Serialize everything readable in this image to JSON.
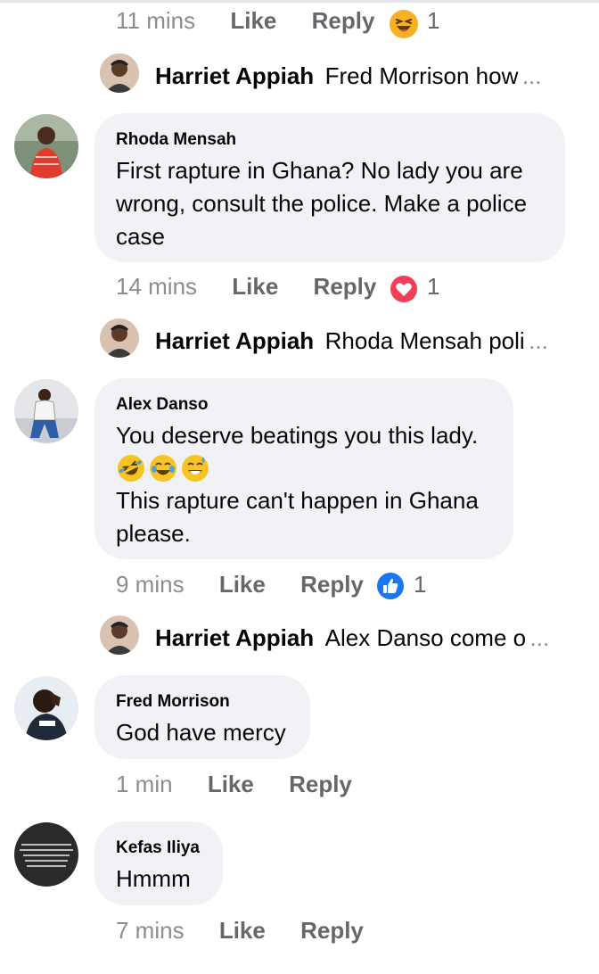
{
  "comments": [
    {
      "id": "c0",
      "meta": {
        "time": "11 mins",
        "like": "Like",
        "reply": "Reply",
        "reaction_count": "1",
        "reaction": "laugh-reaction"
      },
      "reply_preview": {
        "name": "Harriet Appiah",
        "text": "Fred Morrison how",
        "more": "..."
      }
    },
    {
      "id": "c1",
      "author": "Rhoda Mensah",
      "text": "First rapture in Ghana? No lady you are wrong, consult the police. Make a police case",
      "meta": {
        "time": "14 mins",
        "like": "Like",
        "reply": "Reply",
        "reaction_count": "1",
        "reaction": "love-reaction"
      },
      "reply_preview": {
        "name": "Harriet Appiah",
        "text": "Rhoda Mensah poli",
        "more": "..."
      }
    },
    {
      "id": "c2",
      "author": "Alex Danso",
      "text_line1": "You deserve beatings you this lady.",
      "text_line3": "This rapture can't happen in Ghana please.",
      "meta": {
        "time": "9 mins",
        "like": "Like",
        "reply": "Reply",
        "reaction_count": "1",
        "reaction": "like-reaction"
      },
      "reply_preview": {
        "name": "Harriet Appiah",
        "text": "Alex Danso come o",
        "more": "..."
      }
    },
    {
      "id": "c3",
      "author": "Fred Morrison",
      "text": "God have mercy",
      "meta": {
        "time": "1 min",
        "like": "Like",
        "reply": "Reply"
      }
    },
    {
      "id": "c4",
      "author": "Kefas Iliya",
      "text": "Hmmm",
      "meta": {
        "time": "7 mins",
        "like": "Like",
        "reply": "Reply"
      },
      "avatar_text": "WHEN YOU RE AT THE TOP STAY HUMBLE WHEN YOU RE AT THE BOTTOM STAY HOPEFUL BUT ALWAYS STAY HUNGRY"
    }
  ],
  "colors": {
    "bubble": "#f0f2f5",
    "meta_text": "#65676b",
    "love": "#f33e58",
    "like": "#1877f2",
    "haha": "#f7b125"
  }
}
